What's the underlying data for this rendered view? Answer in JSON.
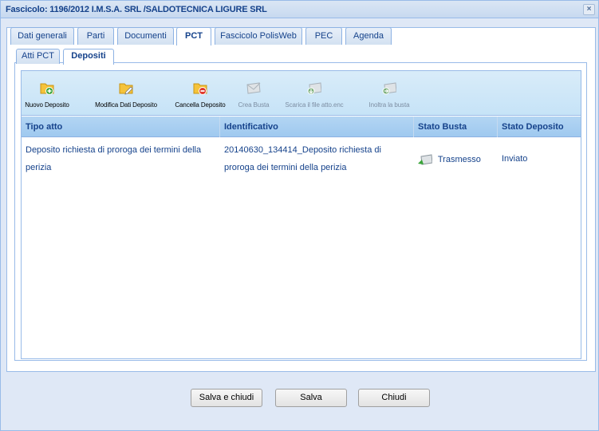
{
  "window": {
    "title": "Fascicolo: 1196/2012 I.M.S.A. SRL /SALDOTECNICA LIGURE SRL",
    "close_symbol": "×"
  },
  "tabs": [
    {
      "label": "Dati generali",
      "active": false
    },
    {
      "label": "Parti",
      "active": false
    },
    {
      "label": "Documenti",
      "active": false
    },
    {
      "label": "PCT",
      "active": true
    },
    {
      "label": "Fascicolo PolisWeb",
      "active": false
    },
    {
      "label": "PEC",
      "active": false
    },
    {
      "label": "Agenda",
      "active": false
    }
  ],
  "subtabs": [
    {
      "label": "Atti PCT",
      "active": false
    },
    {
      "label": "Depositi",
      "active": true
    }
  ],
  "toolbar": {
    "buttons": [
      {
        "label": "Nuovo Deposito",
        "icon": "folder-add-icon",
        "enabled": true
      },
      {
        "label": "Modifica Dati Deposito",
        "icon": "folder-edit-icon",
        "enabled": true
      },
      {
        "label": "Cancella Deposito",
        "icon": "folder-delete-icon",
        "enabled": true
      },
      {
        "label": "Crea Busta",
        "icon": "envelope-icon",
        "enabled": false
      },
      {
        "label": "Scarica il file atto.enc",
        "icon": "download-envelope-icon",
        "enabled": false
      },
      {
        "label": "Inoltra la busta",
        "icon": "send-envelope-icon",
        "enabled": false
      }
    ]
  },
  "grid": {
    "columns": [
      "Tipo atto",
      "Identificativo",
      "Stato Busta",
      "Stato Deposito"
    ],
    "rows": [
      {
        "tipo_atto_line1": "Deposito richiesta di proroga dei termini della",
        "tipo_atto_line2": "perizia",
        "identificativo_line1": "20140630_134414_Deposito richiesta di",
        "identificativo_line2": "proroga dei termini della perizia",
        "stato_busta": "Trasmesso",
        "stato_busta_icon": "sent-envelope-icon",
        "stato_deposito": "Inviato"
      }
    ]
  },
  "footer": {
    "save_close_label": "Salva e chiudi",
    "save_label": "Salva",
    "close_label": "Chiudi"
  },
  "colors": {
    "accent": "#15428b",
    "border": "#99bbe8",
    "toolbar_bg": "#c6e3f7",
    "folder": "#f5c33b",
    "add": "#3aa43a",
    "delete": "#e0382c"
  }
}
